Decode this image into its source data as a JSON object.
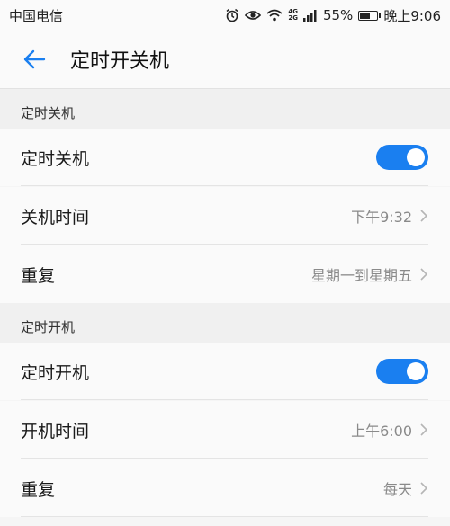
{
  "status_bar": {
    "carrier": "中国电信",
    "network_top": "4G",
    "network_bottom": "2G",
    "battery_percent": "55%",
    "time": "晚上9:06",
    "icons": [
      "alarm-icon",
      "eye-icon",
      "wifi-icon",
      "signal-icon",
      "battery-icon"
    ]
  },
  "app_bar": {
    "title": "定时开关机",
    "back_icon": "arrow-left-icon"
  },
  "colors": {
    "accent": "#1a7ff0",
    "background": "#f5f5f5",
    "row_bg": "#fafafa",
    "secondary_text": "#8a8a8a"
  },
  "sections": [
    {
      "header": "定时关机",
      "rows": [
        {
          "label": "定时关机",
          "type": "toggle",
          "on": true
        },
        {
          "label": "关机时间",
          "type": "value",
          "value": "下午9:32"
        },
        {
          "label": "重复",
          "type": "value",
          "value": "星期一到星期五"
        }
      ]
    },
    {
      "header": "定时开机",
      "rows": [
        {
          "label": "定时开机",
          "type": "toggle",
          "on": true
        },
        {
          "label": "开机时间",
          "type": "value",
          "value": "上午6:00"
        },
        {
          "label": "重复",
          "type": "value",
          "value": "每天"
        }
      ]
    }
  ]
}
